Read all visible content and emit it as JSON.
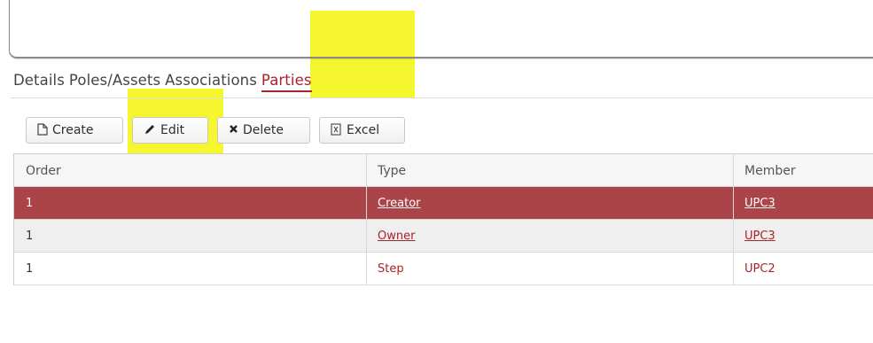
{
  "colors": {
    "accent": "#a8242a",
    "selected_row": "#aa4449",
    "highlight": "#f4f40a"
  },
  "tabs": [
    {
      "label": "Details",
      "active": false
    },
    {
      "label": "Poles/Assets",
      "active": false
    },
    {
      "label": "Associations",
      "active": false
    },
    {
      "label": "Parties",
      "active": true
    }
  ],
  "toolbar": {
    "create": {
      "label": "Create",
      "icon": "document-icon"
    },
    "edit": {
      "label": "Edit",
      "icon": "pencil-icon"
    },
    "delete": {
      "label": "Delete",
      "icon": "x-icon"
    },
    "excel": {
      "label": "Excel",
      "icon": "excel-icon"
    }
  },
  "grid": {
    "columns": [
      "Order",
      "Type",
      "Member"
    ],
    "rows": [
      {
        "order": "1",
        "type": "Creator",
        "member": "UPC3",
        "selected": true
      },
      {
        "order": "1",
        "type": "Owner",
        "member": "UPC3",
        "selected": false
      },
      {
        "order": "1",
        "type": "Step",
        "member": "UPC2",
        "selected": false
      }
    ]
  }
}
